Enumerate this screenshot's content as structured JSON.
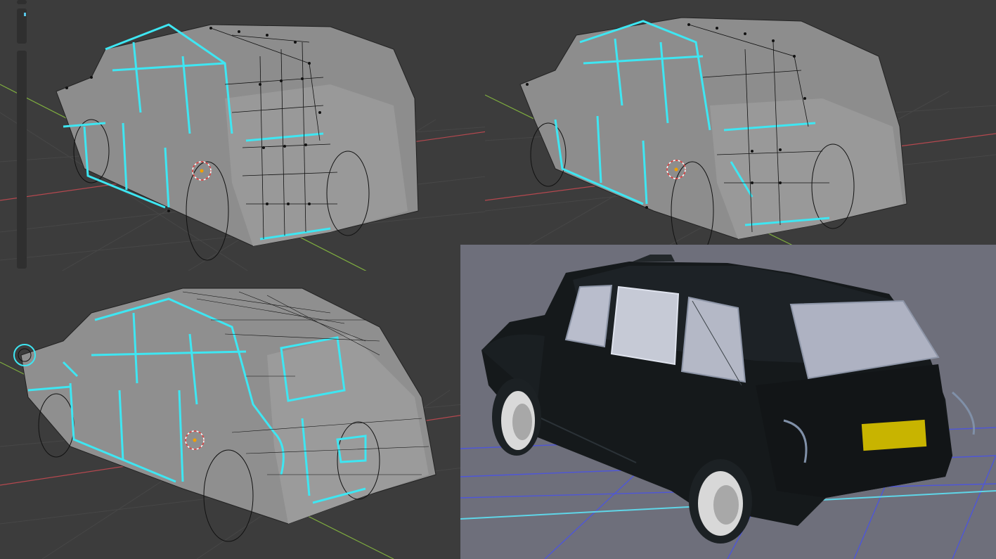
{
  "scene": {
    "viewports": [
      {
        "id": "top-left",
        "mode": "edit-mode-wireframe"
      },
      {
        "id": "top-right",
        "mode": "edit-mode-wireframe"
      },
      {
        "id": "bottom-left",
        "mode": "edit-mode-wireframe"
      },
      {
        "id": "bottom-right",
        "mode": "rendered-preview"
      }
    ]
  },
  "colors": {
    "viewport_bg": "#3c3c3c",
    "grid_line": "#454545",
    "x_axis": "#b5484f",
    "y_axis": "#7fae3f",
    "selected_edge": "#3ee6f2",
    "vertex": "#111111",
    "mesh_fill": "#8c8c8c",
    "render_bg": "#6e6e7a",
    "render_grid": "#4e56d8",
    "render_axis_cyan": "#5fd6e8",
    "car_body": "#15191b",
    "license_plate": "#c8b400",
    "window_glass": "#b9bdcc"
  },
  "icons": {
    "cursor": "3d-cursor-icon",
    "toolbar": "toolbar-strip"
  }
}
